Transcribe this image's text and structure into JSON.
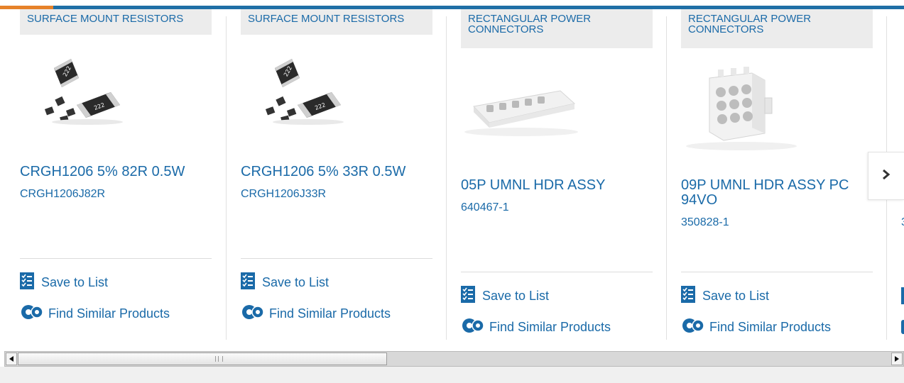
{
  "carousel": {
    "save_label": "Save to List",
    "similar_label": "Find Similar Products",
    "cards": [
      {
        "category": "SURFACE MOUNT RESISTORS",
        "name": "CRGH1206 5% 82R 0.5W",
        "part_number": "CRGH1206J82R",
        "image_icon": "chip-resistor-image"
      },
      {
        "category": "SURFACE MOUNT RESISTORS",
        "name": "CRGH1206 5% 33R 0.5W",
        "part_number": "CRGH1206J33R",
        "image_icon": "chip-resistor-image"
      },
      {
        "category": "RECTANGULAR POWER CONNECTORS",
        "name": "05P UMNL HDR ASSY",
        "part_number": "640467-1",
        "image_icon": "connector-5pin-image"
      },
      {
        "category": "RECTANGULAR POWER CONNECTORS",
        "name": "09P UMNL HDR ASSY PC 94VO",
        "part_number": "350828-1",
        "image_icon": "connector-9pin-image"
      }
    ],
    "peek_part_number_fragment": "3"
  },
  "colors": {
    "link": "#1a6aa8",
    "brand_bar": "#1f6fa6",
    "accent": "#e6822a",
    "category_bg": "#ececec"
  },
  "icons": {
    "save": "checklist-icon",
    "similar": "gears-icon",
    "next": "chevron-right-icon"
  }
}
